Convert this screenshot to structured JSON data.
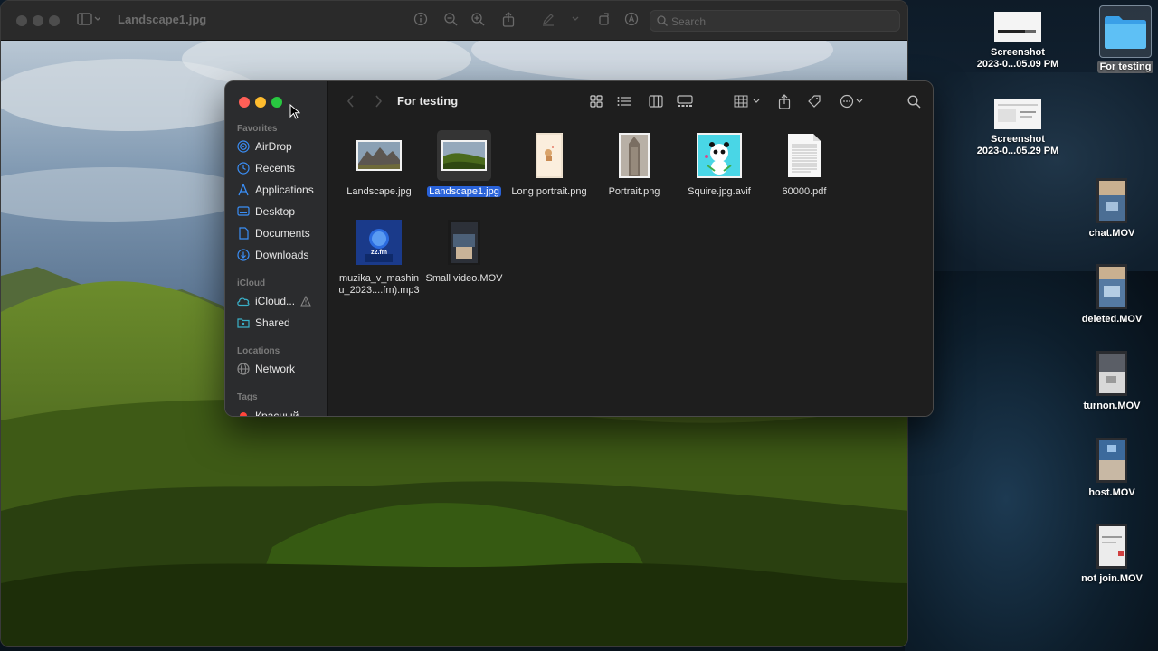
{
  "preview": {
    "title": "Landscape1.jpg",
    "search_placeholder": "Search"
  },
  "finder": {
    "folder_title": "For testing",
    "sidebar": {
      "sections": [
        {
          "label": "Favorites"
        },
        {
          "label": "iCloud"
        },
        {
          "label": "Locations"
        },
        {
          "label": "Tags"
        }
      ],
      "items": [
        {
          "label": "AirDrop",
          "icon": "airdrop-icon"
        },
        {
          "label": "Recents",
          "icon": "clock-icon"
        },
        {
          "label": "Applications",
          "icon": "applications-icon"
        },
        {
          "label": "Desktop",
          "icon": "desktop-icon"
        },
        {
          "label": "Documents",
          "icon": "document-icon"
        },
        {
          "label": "Downloads",
          "icon": "download-icon"
        },
        {
          "label": "iCloud...",
          "icon": "cloud-icon"
        },
        {
          "label": "Shared",
          "icon": "shared-folder-icon"
        },
        {
          "label": "Network",
          "icon": "globe-icon"
        },
        {
          "label": "Красный",
          "icon": "red-tag-icon"
        }
      ]
    },
    "files": [
      {
        "name": "Landscape.jpg",
        "kind": "image"
      },
      {
        "name": "Landscape1.jpg",
        "kind": "image",
        "selected": true
      },
      {
        "name": "Long portrait.png",
        "kind": "image"
      },
      {
        "name": "Portrait.png",
        "kind": "image"
      },
      {
        "name": "Squire.jpg.avif",
        "kind": "image"
      },
      {
        "name": "60000.pdf",
        "kind": "pdf"
      },
      {
        "name_line1": "muzika_v_mashin",
        "name_line2": "u_2023....fm).mp3",
        "kind": "audio",
        "badge": "z2.fm"
      },
      {
        "name": "Small video.MOV",
        "kind": "video"
      }
    ]
  },
  "desktop": {
    "items": [
      {
        "label": "For testing",
        "kind": "folder",
        "selected": true
      },
      {
        "label_line1": "Screenshot",
        "label_line2": "2023-0...05.09 PM",
        "kind": "screenshot"
      },
      {
        "label_line1": "Screenshot",
        "label_line2": "2023-0...05.29 PM",
        "kind": "screenshot"
      },
      {
        "label": "chat.MOV",
        "kind": "video"
      },
      {
        "label": "deleted.MOV",
        "kind": "video"
      },
      {
        "label": "turnon.MOV",
        "kind": "video"
      },
      {
        "label": "host.MOV",
        "kind": "video"
      },
      {
        "label": "not join.MOV",
        "kind": "video"
      }
    ]
  },
  "colors": {
    "accent": "#2962d9",
    "sidebar_icon": "#3a8ef6",
    "close": "#ff5f57",
    "minimize": "#febc2e",
    "zoom": "#28c840",
    "tag_red": "#ff453a"
  }
}
